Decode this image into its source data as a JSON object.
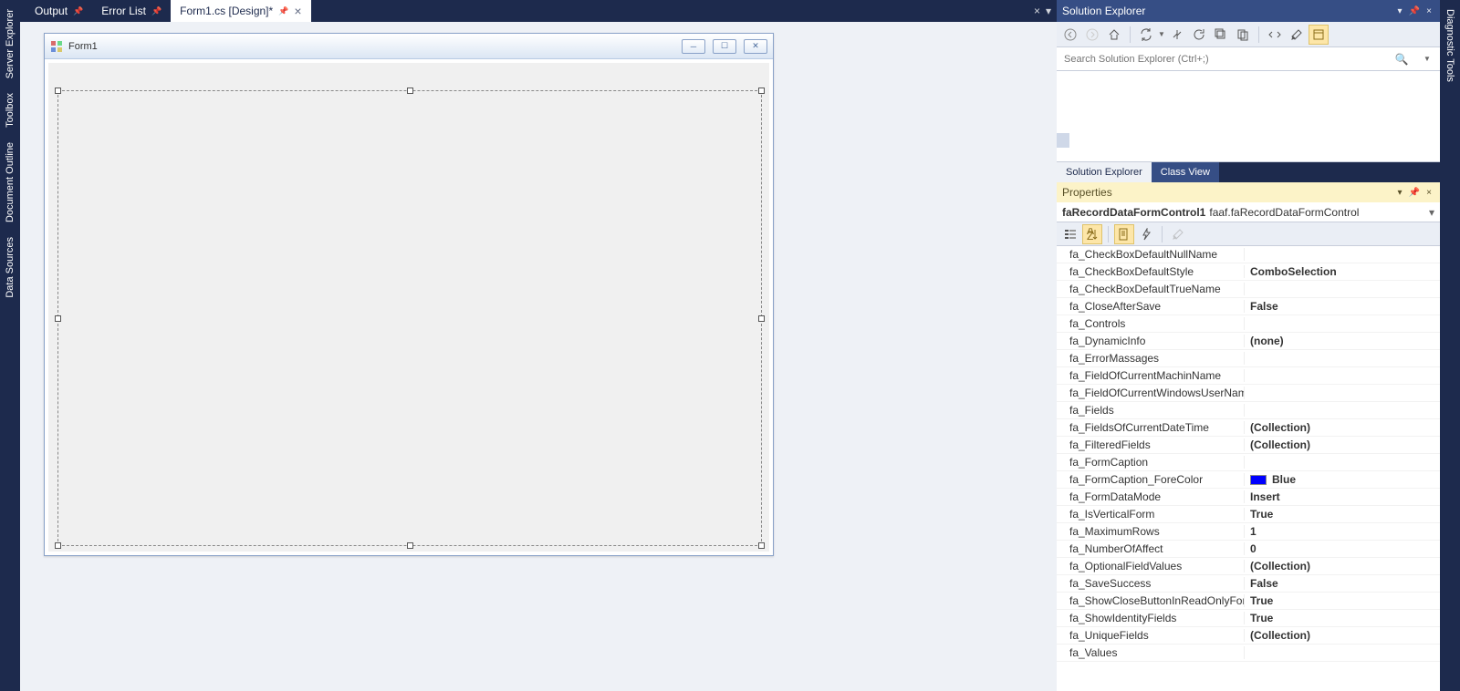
{
  "leftRail": [
    "Server Explorer",
    "Toolbox",
    "Document Outline",
    "Data Sources"
  ],
  "rightRail": [
    "Diagnostic Tools"
  ],
  "tabs": {
    "output": "Output",
    "errorList": "Error List",
    "active": "Form1.cs [Design]*"
  },
  "form": {
    "title": "Form1"
  },
  "solutionExplorer": {
    "title": "Solution Explorer",
    "searchPlaceholder": "Search Solution Explorer (Ctrl+;)",
    "tabActive": "Solution Explorer",
    "tabInactive": "Class View"
  },
  "properties": {
    "title": "Properties",
    "selectedName": "faRecordDataFormControl1",
    "selectedType": "faaf.faRecordDataFormControl",
    "rows": [
      {
        "name": "fa_CheckBoxDefaultNullName",
        "value": "",
        "bold": false
      },
      {
        "name": "fa_CheckBoxDefaultStyle",
        "value": "ComboSelection",
        "bold": true
      },
      {
        "name": "fa_CheckBoxDefaultTrueName",
        "value": "",
        "bold": false
      },
      {
        "name": "fa_CloseAfterSave",
        "value": "False",
        "bold": true
      },
      {
        "name": "fa_Controls",
        "value": "",
        "bold": false
      },
      {
        "name": "fa_DynamicInfo",
        "value": "(none)",
        "bold": true
      },
      {
        "name": "fa_ErrorMassages",
        "value": "",
        "bold": false
      },
      {
        "name": "fa_FieldOfCurrentMachinName",
        "value": "",
        "bold": false
      },
      {
        "name": "fa_FieldOfCurrentWindowsUserName",
        "value": "",
        "bold": false
      },
      {
        "name": "fa_Fields",
        "value": "",
        "bold": false
      },
      {
        "name": "fa_FieldsOfCurrentDateTime",
        "value": "(Collection)",
        "bold": true
      },
      {
        "name": "fa_FilteredFields",
        "value": "(Collection)",
        "bold": true
      },
      {
        "name": "fa_FormCaption",
        "value": "",
        "bold": false
      },
      {
        "name": "fa_FormCaption_ForeColor",
        "value": "Blue",
        "bold": true,
        "color": "#0000ff"
      },
      {
        "name": "fa_FormDataMode",
        "value": "Insert",
        "bold": true
      },
      {
        "name": "fa_IsVerticalForm",
        "value": "True",
        "bold": true
      },
      {
        "name": "fa_MaximumRows",
        "value": "1",
        "bold": true
      },
      {
        "name": "fa_NumberOfAffect",
        "value": "0",
        "bold": true
      },
      {
        "name": "fa_OptionalFieldValues",
        "value": "(Collection)",
        "bold": true
      },
      {
        "name": "fa_SaveSuccess",
        "value": "False",
        "bold": true
      },
      {
        "name": "fa_ShowCloseButtonInReadOnlyForm",
        "value": "True",
        "bold": true
      },
      {
        "name": "fa_ShowIdentityFields",
        "value": "True",
        "bold": true
      },
      {
        "name": "fa_UniqueFields",
        "value": "(Collection)",
        "bold": true
      },
      {
        "name": "fa_Values",
        "value": "",
        "bold": false
      }
    ]
  }
}
